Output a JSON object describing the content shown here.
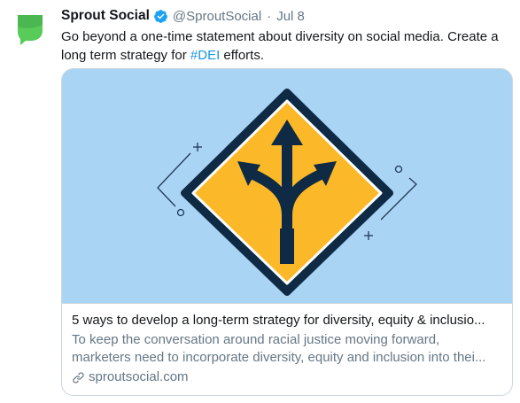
{
  "tweet": {
    "display_name": "Sprout Social",
    "handle": "@SproutSocial",
    "separator": "·",
    "time": "Jul 8",
    "text_before": "Go beyond a one-time statement about diversity on social media. Create a long term strategy for ",
    "hashtag": "#DEI",
    "text_after": " efforts."
  },
  "card": {
    "title": "5 ways to develop a long-term strategy for diversity, equity & inclusio...",
    "description_line1": "To keep the conversation around racial justice moving forward,",
    "description_line2": "marketers need to incorporate diversity, equity and inclusion into thei...",
    "domain": "sproutsocial.com"
  },
  "icons": {
    "avatar": "sprout-leaf-logo-icon",
    "verified": "verified-badge-icon",
    "link": "link-icon",
    "card_art": "road-sign-split-arrows-icon"
  },
  "colors": {
    "brand_green": "#59cb59",
    "verified_blue": "#1da1f2",
    "hashtag_blue": "#1b95e0",
    "card_sky": "#a9d4f4",
    "sign_yellow": "#fbb829",
    "sign_dark": "#0f2a44",
    "muted_text": "#657786"
  }
}
